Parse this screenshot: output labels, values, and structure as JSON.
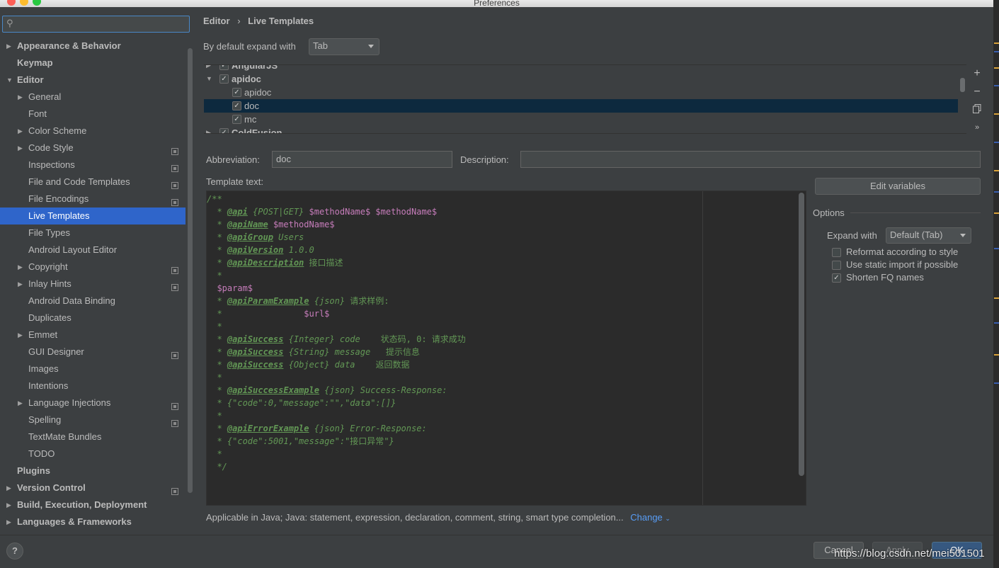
{
  "window": {
    "title": "Preferences"
  },
  "search": {
    "placeholder": "",
    "icon": "search-icon"
  },
  "sidebar": {
    "items": [
      {
        "label": "Appearance & Behavior",
        "bold": true,
        "arrow": "right",
        "level": 0
      },
      {
        "label": "Keymap",
        "bold": true,
        "arrow": "",
        "level": 0
      },
      {
        "label": "Editor",
        "bold": true,
        "arrow": "down",
        "level": 0
      },
      {
        "label": "General",
        "arrow": "right",
        "level": 1
      },
      {
        "label": "Font",
        "arrow": "",
        "level": 1
      },
      {
        "label": "Color Scheme",
        "arrow": "right",
        "level": 1
      },
      {
        "label": "Code Style",
        "arrow": "right",
        "level": 1,
        "project": true
      },
      {
        "label": "Inspections",
        "arrow": "",
        "level": 1,
        "project": true
      },
      {
        "label": "File and Code Templates",
        "arrow": "",
        "level": 1,
        "project": true
      },
      {
        "label": "File Encodings",
        "arrow": "",
        "level": 1,
        "project": true
      },
      {
        "label": "Live Templates",
        "arrow": "",
        "level": 1,
        "selected": true
      },
      {
        "label": "File Types",
        "arrow": "",
        "level": 1
      },
      {
        "label": "Android Layout Editor",
        "arrow": "",
        "level": 1
      },
      {
        "label": "Copyright",
        "arrow": "right",
        "level": 1,
        "project": true
      },
      {
        "label": "Inlay Hints",
        "arrow": "right",
        "level": 1,
        "project": true
      },
      {
        "label": "Android Data Binding",
        "arrow": "",
        "level": 1
      },
      {
        "label": "Duplicates",
        "arrow": "",
        "level": 1
      },
      {
        "label": "Emmet",
        "arrow": "right",
        "level": 1
      },
      {
        "label": "GUI Designer",
        "arrow": "",
        "level": 1,
        "project": true
      },
      {
        "label": "Images",
        "arrow": "",
        "level": 1
      },
      {
        "label": "Intentions",
        "arrow": "",
        "level": 1
      },
      {
        "label": "Language Injections",
        "arrow": "right",
        "level": 1,
        "project": true
      },
      {
        "label": "Spelling",
        "arrow": "",
        "level": 1,
        "project": true
      },
      {
        "label": "TextMate Bundles",
        "arrow": "",
        "level": 1
      },
      {
        "label": "TODO",
        "arrow": "",
        "level": 1
      },
      {
        "label": "Plugins",
        "bold": true,
        "arrow": "",
        "level": 0
      },
      {
        "label": "Version Control",
        "bold": true,
        "arrow": "right",
        "level": 0,
        "project": true
      },
      {
        "label": "Build, Execution, Deployment",
        "bold": true,
        "arrow": "right",
        "level": 0
      },
      {
        "label": "Languages & Frameworks",
        "bold": true,
        "arrow": "right",
        "level": 0
      }
    ]
  },
  "breadcrumb": {
    "parent": "Editor",
    "separator": "›",
    "current": "Live Templates"
  },
  "expand": {
    "label": "By default expand with",
    "value": "Tab"
  },
  "template_list": [
    {
      "label": "AngularJS",
      "group": true,
      "expanded": false,
      "checked": true
    },
    {
      "label": "apidoc",
      "group": true,
      "expanded": true,
      "checked": true
    },
    {
      "label": "apidoc",
      "group": false,
      "checked": true
    },
    {
      "label": "doc",
      "group": false,
      "checked": true,
      "selected": true
    },
    {
      "label": "mc",
      "group": false,
      "checked": true
    },
    {
      "label": "ColdFusion",
      "group": true,
      "expanded": false,
      "checked": true
    }
  ],
  "list_tools": {
    "add": "+",
    "remove": "−",
    "copy": "copy-icon",
    "more": "»"
  },
  "abbreviation": {
    "label": "Abbreviation:",
    "value": "doc"
  },
  "description": {
    "label": "Description:",
    "value": ""
  },
  "template_text": {
    "label": "Template text:",
    "lines": [
      [
        {
          "t": "/**"
        }
      ],
      [
        {
          "t": "  * "
        },
        {
          "t": "@api",
          "c": "tag"
        },
        {
          "t": " {POST|GET} "
        },
        {
          "t": "$methodName$ $methodName$",
          "c": "var"
        }
      ],
      [
        {
          "t": "  * "
        },
        {
          "t": "@apiName",
          "c": "tag"
        },
        {
          "t": " "
        },
        {
          "t": "$methodName$",
          "c": "var"
        }
      ],
      [
        {
          "t": "  * "
        },
        {
          "t": "@apiGroup",
          "c": "tag"
        },
        {
          "t": " Users"
        }
      ],
      [
        {
          "t": "  * "
        },
        {
          "t": "@apiVersion",
          "c": "tag"
        },
        {
          "t": " 1.0.0"
        }
      ],
      [
        {
          "t": "  * "
        },
        {
          "t": "@apiDescription",
          "c": "tag"
        },
        {
          "t": " "
        },
        {
          "t": "接口描述",
          "c": "cjk"
        }
      ],
      [
        {
          "t": "  *"
        }
      ],
      [
        {
          "t": "  "
        },
        {
          "t": "$param$",
          "c": "var"
        }
      ],
      [
        {
          "t": "  * "
        },
        {
          "t": "@apiParamExample",
          "c": "tag"
        },
        {
          "t": " {json} "
        },
        {
          "t": "请求样例:",
          "c": "cjk"
        }
      ],
      [
        {
          "t": "  *                "
        },
        {
          "t": "$url$",
          "c": "var"
        }
      ],
      [
        {
          "t": "  *"
        }
      ],
      [
        {
          "t": "  * "
        },
        {
          "t": "@apiSuccess",
          "c": "tag"
        },
        {
          "t": " {Integer} code    "
        },
        {
          "t": "状态码, 0: 请求成功",
          "c": "cjk"
        }
      ],
      [
        {
          "t": "  * "
        },
        {
          "t": "@apiSuccess",
          "c": "tag"
        },
        {
          "t": " {String} message   "
        },
        {
          "t": "提示信息",
          "c": "cjk"
        }
      ],
      [
        {
          "t": "  * "
        },
        {
          "t": "@apiSuccess",
          "c": "tag"
        },
        {
          "t": " {Object} data    "
        },
        {
          "t": "返回数据",
          "c": "cjk"
        }
      ],
      [
        {
          "t": "  *"
        }
      ],
      [
        {
          "t": "  * "
        },
        {
          "t": "@apiSuccessExample",
          "c": "tag"
        },
        {
          "t": " {json} Success-Response:"
        }
      ],
      [
        {
          "t": "  * {\"code\":0,\"message\":\"\",\"data\":[]}"
        }
      ],
      [
        {
          "t": "  *"
        }
      ],
      [
        {
          "t": "  * "
        },
        {
          "t": "@apiErrorExample",
          "c": "tag"
        },
        {
          "t": " {json} Error-Response:"
        }
      ],
      [
        {
          "t": "  * {\"code\":5001,\"message\":\""
        },
        {
          "t": "接口异常",
          "c": "cjk"
        },
        {
          "t": "\"}"
        }
      ],
      [
        {
          "t": "  *"
        }
      ],
      [
        {
          "t": "  */"
        }
      ]
    ]
  },
  "edit_variables": {
    "label": "Edit variables"
  },
  "options": {
    "title": "Options",
    "expand_label": "Expand with",
    "expand_value": "Default (Tab)",
    "checkboxes": [
      {
        "label": "Reformat according to style",
        "checked": false
      },
      {
        "label": "Use static import if possible",
        "checked": false
      },
      {
        "label": "Shorten FQ names",
        "checked": true
      }
    ]
  },
  "applicable": {
    "text": "Applicable in Java; Java: statement, expression, declaration, comment, string, smart type completion...",
    "link": "Change"
  },
  "footer": {
    "help": "?",
    "cancel": "Cancel",
    "apply": "Apply",
    "ok": "OK"
  },
  "watermark": "https://blog.csdn.net/mei501501",
  "colors": {
    "accent": "#2f65ca",
    "link": "#589df6",
    "background": "#3c3f41",
    "editor_bg": "#2b2b2b",
    "comment": "#629755",
    "variable": "#c77dbb"
  }
}
